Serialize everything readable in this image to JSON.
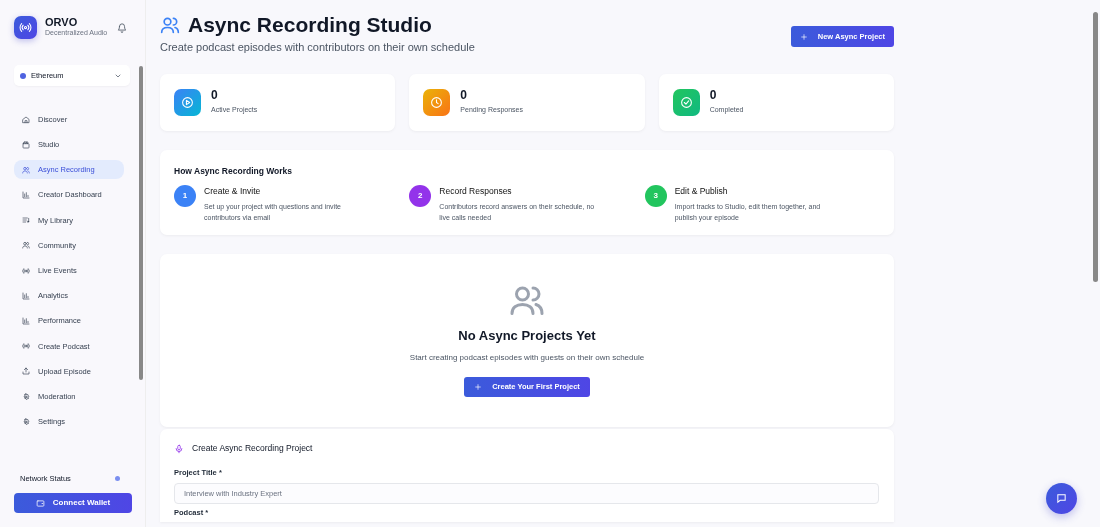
{
  "brand": {
    "name": "ORVO",
    "tagline": "Decentralized Audio"
  },
  "network_select": {
    "value": "Ethereum"
  },
  "nav": [
    {
      "label": "Discover",
      "selected": false
    },
    {
      "label": "Studio",
      "selected": false
    },
    {
      "label": "Async Recording",
      "selected": true
    },
    {
      "label": "Creator Dashboard",
      "selected": false
    },
    {
      "label": "My Library",
      "selected": false
    },
    {
      "label": "Community",
      "selected": false
    },
    {
      "label": "Live Events",
      "selected": false
    },
    {
      "label": "Analytics",
      "selected": false
    },
    {
      "label": "Performance",
      "selected": false
    },
    {
      "label": "Create Podcast",
      "selected": false
    },
    {
      "label": "Upload Episode",
      "selected": false
    },
    {
      "label": "Moderation",
      "selected": false
    },
    {
      "label": "Settings",
      "selected": false
    }
  ],
  "network_status": {
    "label": "Network Status"
  },
  "connect_button": "Connect Wallet",
  "header": {
    "title": "Async Recording Studio",
    "subtitle": "Create podcast episodes with contributors on their own schedule",
    "button": "New Async Project"
  },
  "stats": [
    {
      "value": "0",
      "label": "Active Projects",
      "kind": "play"
    },
    {
      "value": "0",
      "label": "Pending Responses",
      "kind": "clock"
    },
    {
      "value": "0",
      "label": "Completed",
      "kind": "check"
    }
  ],
  "how": {
    "title": "How Async Recording Works",
    "steps": [
      {
        "number": "1",
        "title": "Create & Invite",
        "text": "Set up your project with questions and invite contributors via email",
        "color": "#3b82f6"
      },
      {
        "number": "2",
        "title": "Record Responses",
        "text": "Contributors record answers on their schedule, no live calls needed",
        "color": "#9333ea"
      },
      {
        "number": "3",
        "title": "Edit & Publish",
        "text": "Import tracks to Studio, edit them together, and publish your episode",
        "color": "#22c55e"
      }
    ]
  },
  "empty_state": {
    "title": "No Async Projects Yet",
    "text": "Start creating podcast episodes with guests on their own schedule",
    "button": "Create Your First Project"
  },
  "form": {
    "title": "Create Async Recording Project",
    "fields": [
      {
        "label": "Project Title *",
        "placeholder": "Interview with Industry Expert"
      }
    ],
    "next_label": "Podcast *"
  }
}
